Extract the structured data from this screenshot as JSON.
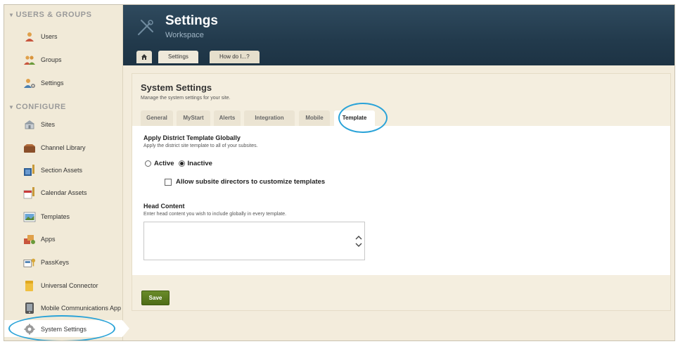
{
  "sidebar": {
    "sections": [
      {
        "heading": "USERS & GROUPS",
        "items": [
          {
            "label": "Users",
            "icon": "user-icon"
          },
          {
            "label": "Groups",
            "icon": "group-icon"
          },
          {
            "label": "Settings",
            "icon": "user-settings-icon"
          }
        ]
      },
      {
        "heading": "CONFIGURE",
        "items": [
          {
            "label": "Sites",
            "icon": "sites-icon"
          },
          {
            "label": "Channel Library",
            "icon": "channel-library-icon"
          },
          {
            "label": "Section Assets",
            "icon": "section-assets-icon"
          },
          {
            "label": "Calendar Assets",
            "icon": "calendar-assets-icon"
          },
          {
            "label": "Templates",
            "icon": "templates-icon"
          },
          {
            "label": "Apps",
            "icon": "apps-icon"
          },
          {
            "label": "PassKeys",
            "icon": "passkeys-icon"
          },
          {
            "label": "Universal Connector",
            "icon": "universal-connector-icon"
          },
          {
            "label": "Mobile Communications App",
            "icon": "mobile-app-icon"
          },
          {
            "label": "System Settings",
            "icon": "system-settings-icon",
            "active": true
          }
        ]
      }
    ]
  },
  "header": {
    "title": "Settings",
    "subtitle": "Workspace",
    "tabs": [
      {
        "label": "Settings",
        "active": true
      },
      {
        "label": "How do I...?"
      }
    ]
  },
  "main": {
    "title": "System Settings",
    "description": "Manage the system settings for your site.",
    "tabs": [
      {
        "label": "General"
      },
      {
        "label": "MyStart"
      },
      {
        "label": "Alerts"
      },
      {
        "label": "Integration"
      },
      {
        "label": "Mobile"
      },
      {
        "label": "Template",
        "active": true
      }
    ],
    "template": {
      "apply_title": "Apply District Template Globally",
      "apply_desc": "Apply the district site template to all of your subsites.",
      "options": [
        {
          "label": "Active",
          "checked": false
        },
        {
          "label": "Inactive",
          "checked": true
        }
      ],
      "allow_customize_label": "Allow subsite directors to customize templates",
      "allow_customize_checked": false,
      "head_title": "Head Content",
      "head_desc": "Enter head content you wish to include globally in every template.",
      "head_value": ""
    },
    "save_label": "Save"
  },
  "colors": {
    "header_bg": "#223a4c",
    "sidebar_bg": "#f1ead8",
    "panel_bg": "#f4eedf",
    "save_green": "#5a7a1f",
    "highlight": "#2aa3d8"
  }
}
